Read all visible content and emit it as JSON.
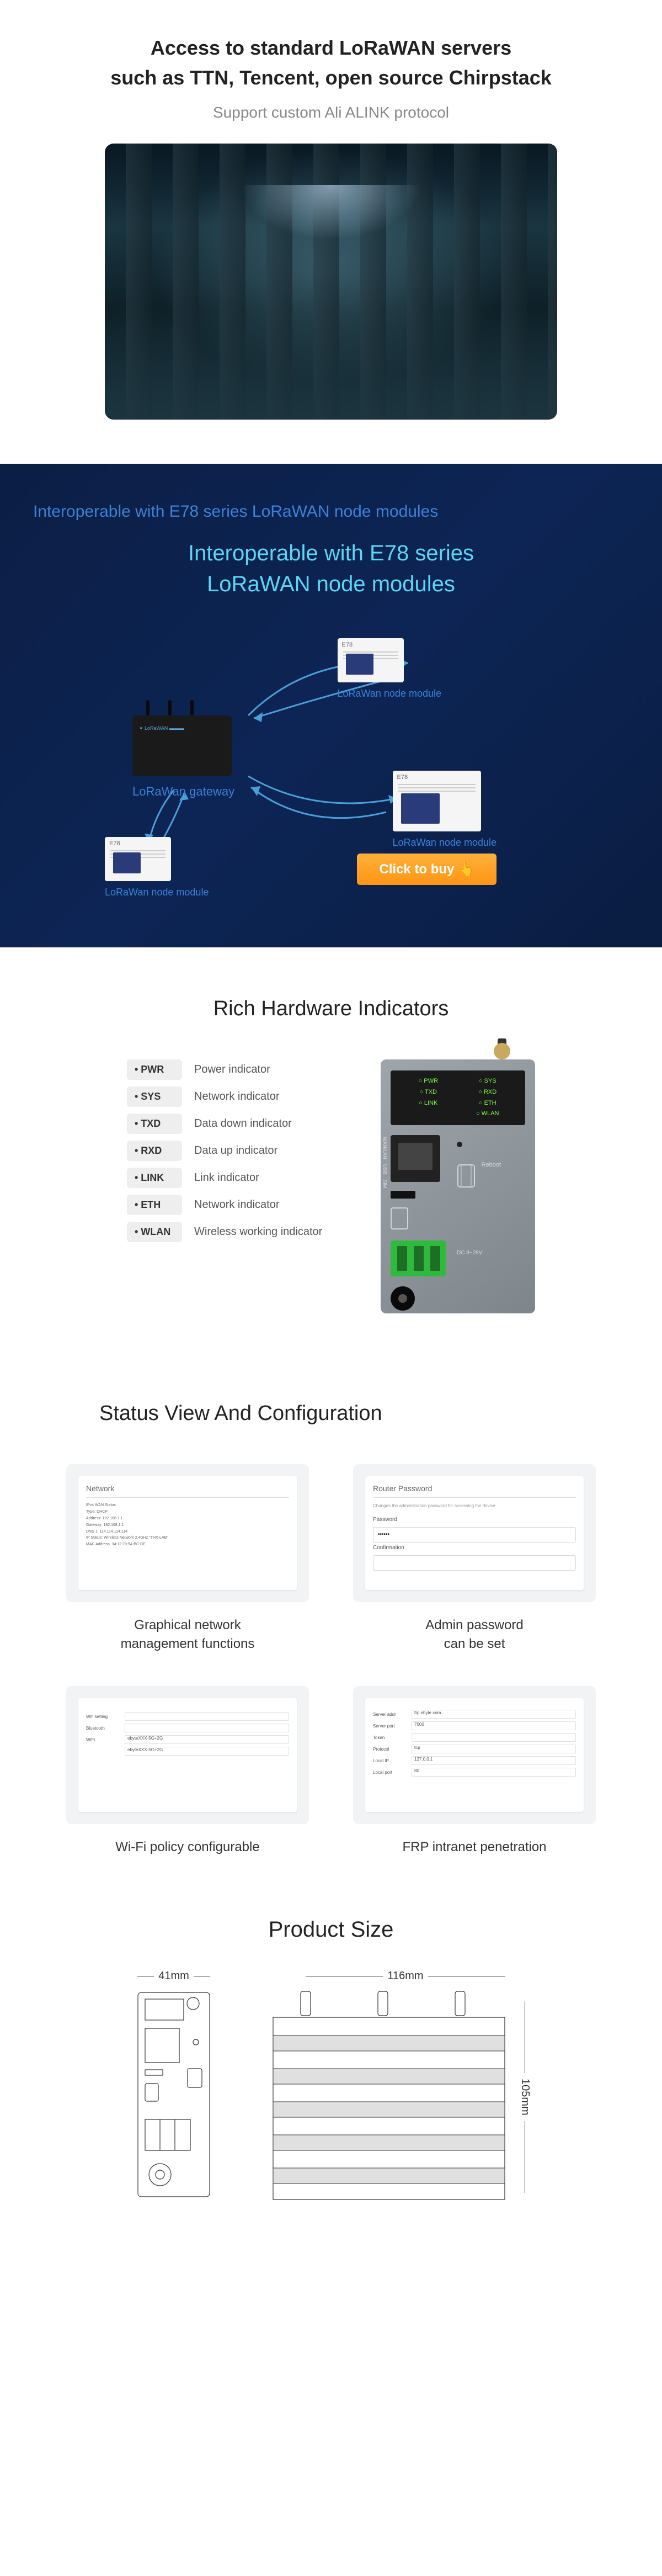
{
  "section1": {
    "title_line1": "Access to standard LoRaWAN servers",
    "title_line2": "such as TTN, Tencent, open source Chirpstack",
    "subtitle": "Support custom Ali ALINK protocol"
  },
  "section2": {
    "blue_title": "Interoperable with E78 series LoRaWAN node modules",
    "cyan_title": "Interoperable with E78 series LoRaWAN node modules",
    "gateway_label": "LoRaWan gateway",
    "node_label": "LoRaWan node module",
    "buy_button": "Click to buy"
  },
  "section3": {
    "title": "Rich Hardware Indicators",
    "indicators": [
      {
        "code": "PWR",
        "desc": "Power indicator"
      },
      {
        "code": "SYS",
        "desc": "Network indicator"
      },
      {
        "code": "TXD",
        "desc": "Data down indicator"
      },
      {
        "code": "RXD",
        "desc": "Data up indicator"
      },
      {
        "code": "LINK",
        "desc": "Link indicator"
      },
      {
        "code": "ETH",
        "desc": "Network indicator"
      },
      {
        "code": "WLAN",
        "desc": "Wireless working indicator"
      }
    ],
    "device_leds": [
      "PWR",
      "SYS",
      "TXD",
      "RXD",
      "LINK",
      "ETH",
      "",
      "WLAN"
    ],
    "side_labels": [
      "WAN/LAN",
      "USB",
      "SIM"
    ],
    "reboot": "Reboot",
    "dc_label": "DC 8~28V"
  },
  "section4": {
    "title": "Status View And Configuration",
    "items": [
      {
        "label": "Graphical network management functions",
        "card": "network"
      },
      {
        "label": "Admin password can be set",
        "card": "password"
      },
      {
        "label": "Wi-Fi policy configurable",
        "card": "wifi"
      },
      {
        "label": "FRP intranet penetration",
        "card": "frp"
      }
    ],
    "network_card": {
      "title": "Network",
      "lines": [
        "IPv4 WAN Status",
        "Type: DHCP",
        "Address: 192.168.1.1",
        "Gateway: 192.168.1.1",
        "DNS 1: 114.114.114.114",
        " ",
        "IP Status: Wireless Network 2.4GHz \"THX-LAB\"",
        "MAC Address: 34:12:78:9A:BC:DE"
      ]
    },
    "password_card": {
      "title": "Router Password",
      "hint": "Changes the administration password for accessing the device",
      "pw_label": "Password",
      "cf_label": "Confirmation"
    },
    "wifi_card": {
      "rows": [
        {
          "l": "Wifi setting",
          "v": ""
        },
        {
          "l": "Bluetooth",
          "v": ""
        },
        {
          "l": "WiFi",
          "v": "ebyteXXX-5G+2G"
        },
        {
          "l": "",
          "v": "ebyteXXX-5G+2G"
        }
      ]
    },
    "frp_card": {
      "rows": [
        {
          "l": "Server addr",
          "v": "frp.ebyte.com"
        },
        {
          "l": "Server port",
          "v": "7000"
        },
        {
          "l": "Token",
          "v": ""
        },
        {
          "l": "Protocol",
          "v": "tcp"
        },
        {
          "l": "Local IP",
          "v": "127.0.0.1"
        },
        {
          "l": "Local port",
          "v": "80"
        }
      ]
    }
  },
  "section5": {
    "title": "Product Size",
    "width_front": "41mm",
    "width_side": "116mm",
    "height_side": "105mm"
  }
}
